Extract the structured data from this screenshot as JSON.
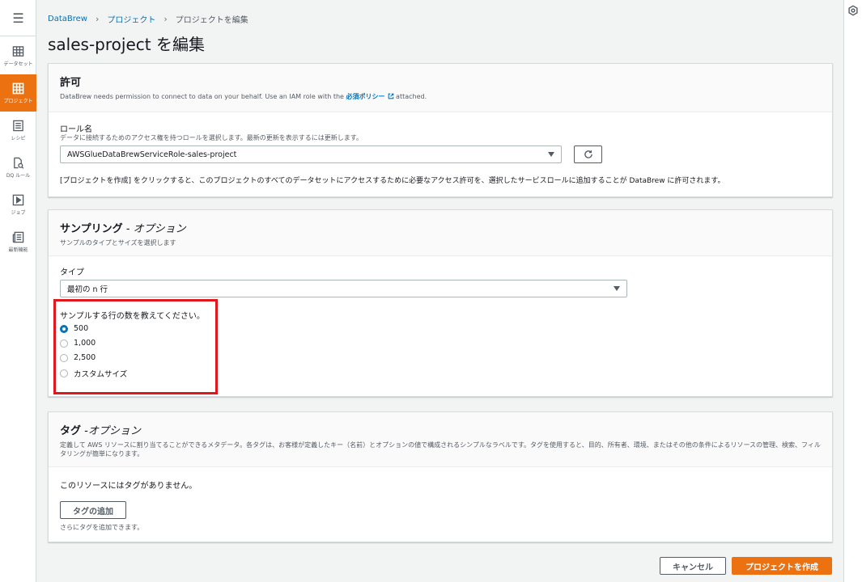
{
  "nav": {
    "menu_icon": "hamburger-icon",
    "items": [
      {
        "label": "データセット",
        "icon": "table-icon",
        "active": false
      },
      {
        "label": "プロジェクト",
        "icon": "project-grid-icon",
        "active": true
      },
      {
        "label": "レシピ",
        "icon": "list-icon",
        "active": false
      },
      {
        "label": "DQ ルール",
        "icon": "document-search-icon",
        "active": false
      },
      {
        "label": "ジョブ",
        "icon": "play-icon",
        "active": false
      },
      {
        "label": "最新機能",
        "icon": "newspaper-icon",
        "active": false
      }
    ]
  },
  "breadcrumb": {
    "items": [
      "DataBrew",
      "プロジェクト",
      "プロジェクトを編集"
    ]
  },
  "page": {
    "title": "sales-project を編集"
  },
  "permissions": {
    "title": "許可",
    "desc_before": "DataBrew needs permission to connect to data on your behalf. Use an IAM role with the ",
    "desc_link": "必須ポリシー",
    "desc_after": " attached.",
    "role_label": "ロール名",
    "role_hint": "データに接続するためのアクセス権を持つロールを選択します。最新の更新を表示するには更新します。",
    "role_value": "AWSGlueDataBrewServiceRole-sales-project",
    "note": "[プロジェクトを作成] をクリックすると、このプロジェクトのすべてのデータセットにアクセスするために必要なアクセス許可を、選択したサービスロールに追加することが DataBrew に許可されます。"
  },
  "sampling": {
    "title": "サンプリング",
    "title_optional": " - オプション",
    "desc": "サンプルのタイプとサイズを選択します",
    "type_label": "タイプ",
    "type_value": "最初の n 行",
    "rows_label": "サンプルする行の数を教えてください。",
    "options": [
      "500",
      "1,000",
      "2,500",
      "カスタムサイズ"
    ],
    "selected_option": "500"
  },
  "tags": {
    "title": "タグ",
    "title_optional": " -オプション",
    "desc": "定義して AWS リソースに割り当てることができるメタデータ。各タグは、お客様が定義したキー（名前）とオプションの値で構成されるシンプルなラベルです。タグを使用すると、目的、所有者、環境、またはその他の条件によるリソースの管理、検索、フィルタリングが簡単になります。",
    "empty": "このリソースにはタグがありません。",
    "add_button": "タグの追加",
    "add_hint": "さらにタグを追加できます。"
  },
  "footer": {
    "cancel": "キャンセル",
    "submit": "プロジェクトを作成"
  },
  "colors": {
    "accent": "#ec7211",
    "link": "#0073bb",
    "highlight": "#e0181d"
  }
}
